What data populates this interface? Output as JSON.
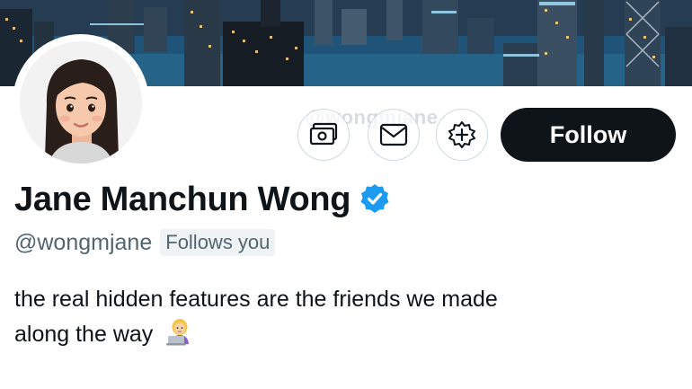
{
  "profile": {
    "watermark": "@wongmjane",
    "display_name": "Jane Manchun Wong",
    "handle": "@wongmjane",
    "follows_you": "Follows you",
    "bio_line1": "the real hidden features are the friends we made",
    "bio_line2": "along the way",
    "bio_emoji": "woman-technologist-emoji",
    "verified": true
  },
  "actions": {
    "tip_icon": "money-icon",
    "message_icon": "envelope-icon",
    "subscribe_icon": "notification-plus-icon",
    "follow_label": "Follow"
  },
  "colors": {
    "verified_blue": "#1d9bf0",
    "follow_bg": "#0f1419",
    "secondary_text": "#536471"
  }
}
